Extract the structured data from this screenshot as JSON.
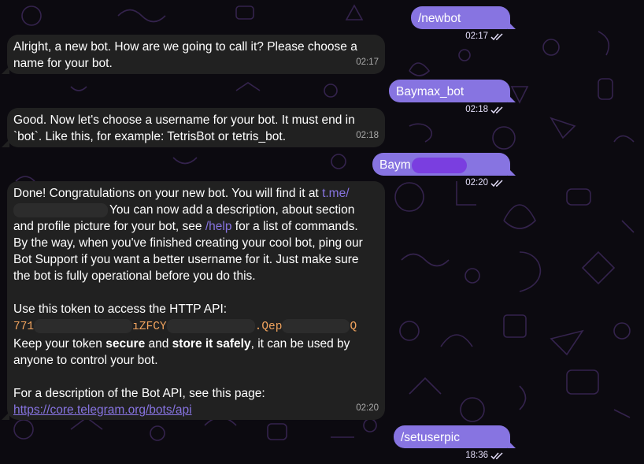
{
  "messages": {
    "m1": {
      "text": "/newbot",
      "time": "02:17"
    },
    "m2": {
      "text": "Alright, a new bot. How are we going to call it? Please choose a name for your bot.",
      "time": "02:17"
    },
    "m3": {
      "text": "Baymax_bot",
      "time": "02:18"
    },
    "m4": {
      "text": "Good. Now let's choose a username for your bot. It must end in `bot`. Like this, for example: TetrisBot or tetris_bot.",
      "time": "02:18"
    },
    "m5": {
      "text_visible": "Baym",
      "time": "02:20"
    },
    "m6": {
      "p1_a": "Done! Congratulations on your new bot. You will find it at ",
      "p1_link": "t.me/",
      "p1_b": "You can now add a description, about section and profile picture for your bot, see ",
      "p1_cmd": "/help",
      "p1_c": " for a list of commands. By the way, when you've finished creating your cool bot, ping our Bot Support if you want a better username for it. Just make sure the bot is fully operational before you do this.",
      "p2_label": "Use this token to access the HTTP API:",
      "token_part1": "771",
      "token_part2": "ıZFCY",
      "token_part3": ".Qep",
      "token_part4": "Q",
      "p3_a": "Keep your token ",
      "p3_b1": "secure",
      "p3_c": " and ",
      "p3_b2": "store it safely",
      "p3_d": ", it can be used by anyone to control your bot.",
      "p4_a": "For a description of the Bot API, see this page: ",
      "p4_link": "https://core.telegram.org/bots/api",
      "time": "02:20"
    },
    "m7": {
      "text": "/setuserpic",
      "time": "18:36"
    }
  },
  "colors": {
    "background": "#0c0a10",
    "incoming_bubble": "#212121",
    "outgoing_bubble": "#8774e1",
    "link": "#8774e1",
    "token": "#f0a35e"
  },
  "icons": {
    "read_receipt": "double-check-icon"
  }
}
